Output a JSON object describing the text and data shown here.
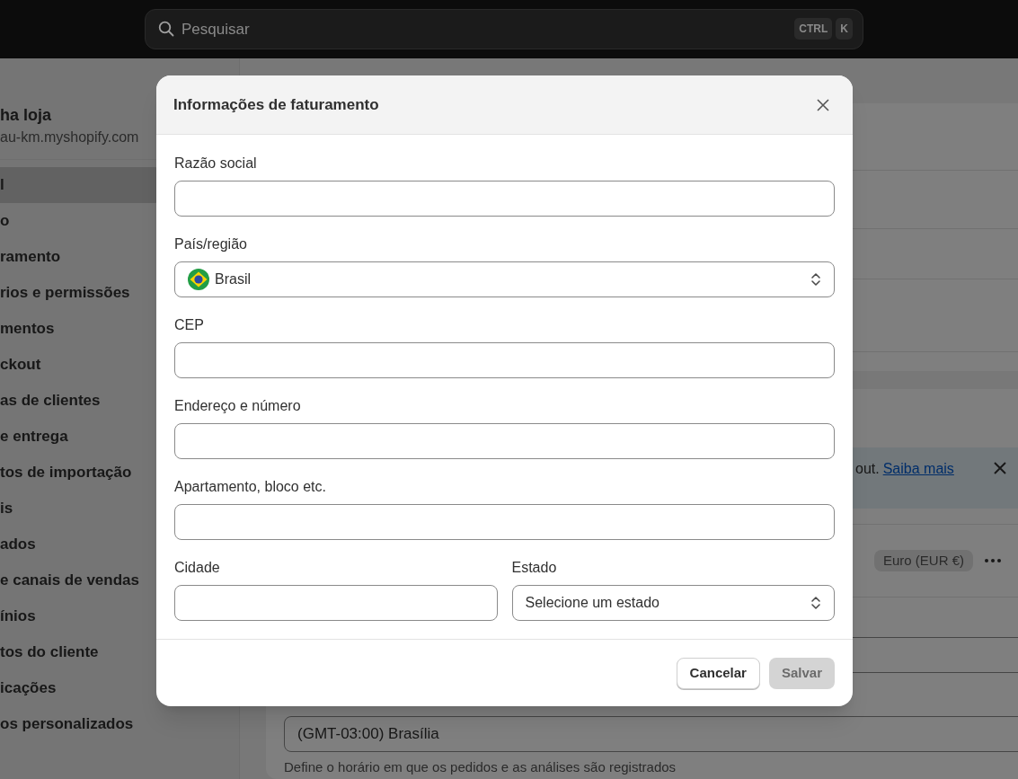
{
  "top_bar": {
    "search": {
      "placeholder": "Pesquisar"
    },
    "shortcut_keys": [
      "CTRL",
      "K"
    ]
  },
  "sidebar": {
    "store_name": "ha loja",
    "store_url": "au-km.myshopify.com",
    "items": [
      {
        "label": "l",
        "selected": true
      },
      {
        "label": "o",
        "selected": false
      },
      {
        "label": "ramento",
        "selected": false
      },
      {
        "label": "rios e permissões",
        "selected": false
      },
      {
        "label": "mentos",
        "selected": false
      },
      {
        "label": "ckout",
        "selected": false
      },
      {
        "label": "as de clientes",
        "selected": false
      },
      {
        "label": "e entrega",
        "selected": false
      },
      {
        "label": "tos de importação",
        "selected": false
      },
      {
        "label": "is",
        "selected": false
      },
      {
        "label": "ados",
        "selected": false
      },
      {
        "label": "e canais de vendas",
        "selected": false
      },
      {
        "label": "ínios",
        "selected": false
      },
      {
        "label": "tos do cliente",
        "selected": false
      },
      {
        "label": "icações",
        "selected": false
      },
      {
        "label": "os personalizados",
        "selected": false
      }
    ]
  },
  "background": {
    "banner": {
      "text": "out.",
      "link": "Saiba mais"
    },
    "currency_badge": "Euro (EUR €)",
    "timezone": {
      "value": "(GMT-03:00) Brasília",
      "help": "Define o horário em que os pedidos e as análises são registrados"
    }
  },
  "dialog": {
    "title": "Informações de faturamento",
    "rows": [
      [
        {
          "kind": "text",
          "label": "Razão social"
        }
      ],
      [
        {
          "kind": "select",
          "label": "País/região",
          "value": "Brasil",
          "flag": true
        }
      ],
      [
        {
          "kind": "text",
          "label": "CEP"
        }
      ],
      [
        {
          "kind": "text",
          "label": "Endereço e número"
        }
      ],
      [
        {
          "kind": "text",
          "label": "Apartamento, bloco etc."
        }
      ],
      [
        {
          "kind": "text",
          "label": "Cidade"
        },
        {
          "kind": "select",
          "label": "Estado",
          "value": "Selecione um estado"
        }
      ]
    ],
    "buttons": [
      {
        "label": "Cancelar",
        "primary": false,
        "disabled": false
      },
      {
        "label": "Salvar",
        "primary": true,
        "disabled": true
      }
    ]
  }
}
